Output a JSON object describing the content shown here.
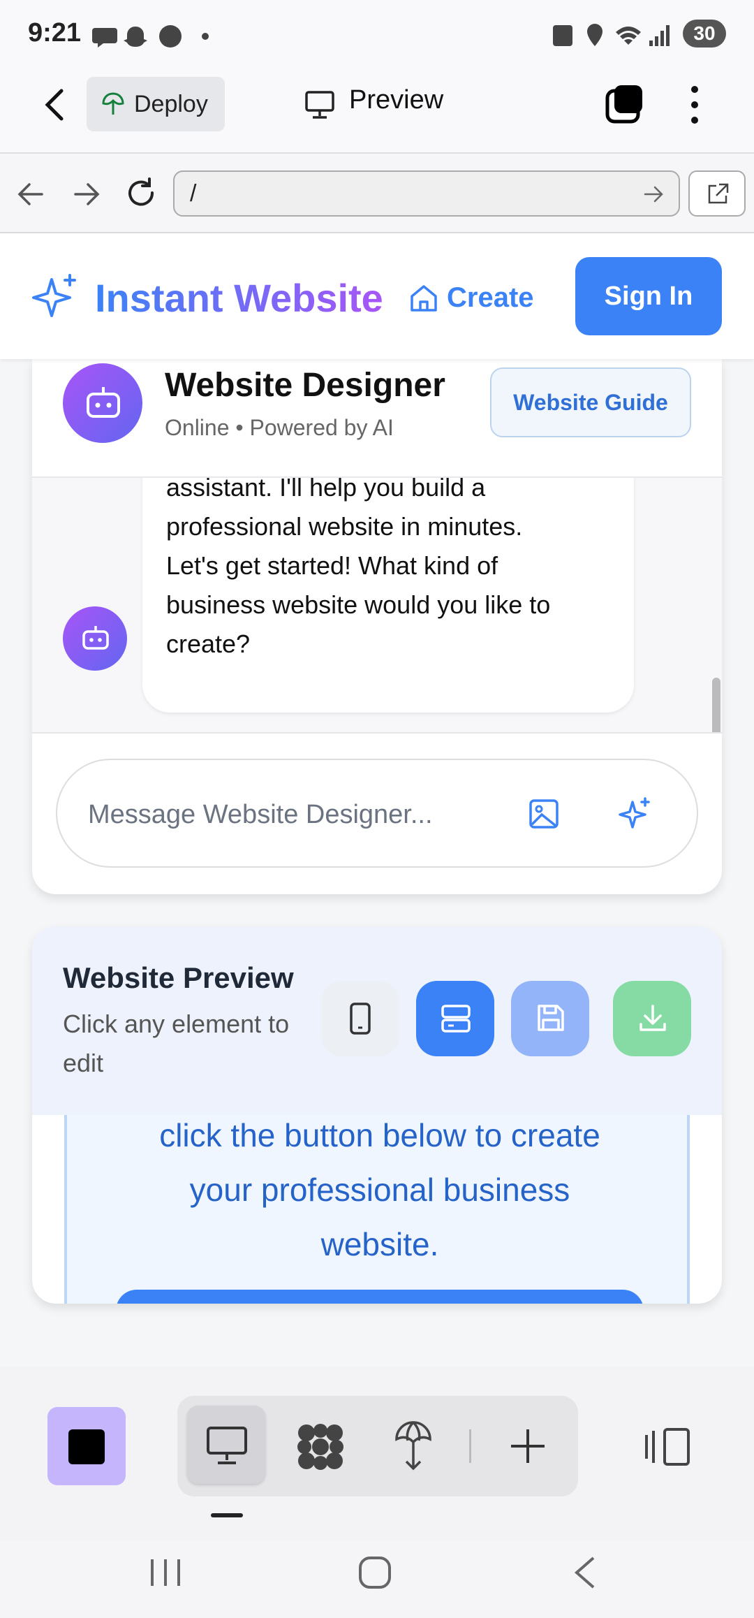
{
  "status_bar": {
    "time": "9:21",
    "battery": "30"
  },
  "app_bar": {
    "deploy_label": "Deploy",
    "title": "Preview"
  },
  "browser": {
    "url": "/"
  },
  "site_header": {
    "brand": "Instant Website",
    "create_label": "Create",
    "signin_label": "Sign In"
  },
  "chat": {
    "bot_name": "Website Designer",
    "bot_status": "Online • Powered by AI",
    "guide_button": "Website Guide",
    "message_lines": [
      "assistant. I'll help you build a",
      "professional website in minutes.",
      "Let's get started! What kind of",
      "business website would you like to",
      "create?"
    ],
    "input_placeholder": "Message Website Designer..."
  },
  "preview": {
    "title": "Website Preview",
    "subtitle": "Click any element to edit",
    "content_lines": [
      "click the button below to create",
      "your professional business",
      "website."
    ]
  },
  "colors": {
    "primary": "#3b82f6",
    "brand_gradient_start": "#3b82f6",
    "brand_gradient_end": "#a855f7",
    "save_button": "#93b4f8",
    "download_button": "#86dba5",
    "app_button": "#c4b5fd"
  },
  "icons": {
    "status": [
      "messenger-icon",
      "snapchat-icon",
      "chat-bubble-icon",
      "nfc-icon",
      "location-icon",
      "wifi-icon",
      "signal-icon"
    ],
    "app_bar": [
      "back-icon",
      "leaf-icon",
      "monitor-icon",
      "tabs-icon",
      "more-vert-icon"
    ],
    "browser": [
      "arrow-left-icon",
      "arrow-right-icon",
      "reload-icon",
      "go-arrow-icon",
      "external-link-icon"
    ],
    "chat": [
      "sparkle-icon",
      "home-icon",
      "bot-icon",
      "image-icon"
    ],
    "preview": [
      "mobile-icon",
      "desktop-icon",
      "save-icon",
      "download-icon"
    ],
    "dock": [
      "monitor-icon",
      "grid-icon",
      "deploy-icon",
      "plus-icon",
      "panel-icon"
    ],
    "system_nav": [
      "recents-icon",
      "home-icon",
      "back-icon"
    ]
  }
}
